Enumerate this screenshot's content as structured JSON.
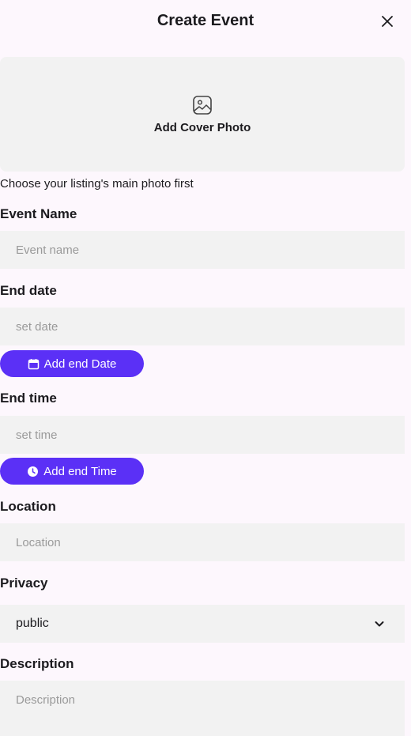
{
  "header": {
    "title": "Create Event"
  },
  "cover": {
    "label": "Add Cover Photo",
    "hint": "Choose your listing's main photo first"
  },
  "event_name": {
    "label": "Event Name",
    "placeholder": "Event name"
  },
  "end_date": {
    "label": "End date",
    "placeholder": "set date",
    "button": "Add end Date"
  },
  "end_time": {
    "label": "End time",
    "placeholder": "set time",
    "button": "Add end Time"
  },
  "location": {
    "label": "Location",
    "placeholder": "Location"
  },
  "privacy": {
    "label": "Privacy",
    "value": "public"
  },
  "description": {
    "label": "Description",
    "placeholder": "Description"
  },
  "colors": {
    "accent": "#5b30f6",
    "field_bg": "#f2f2f2",
    "page_bg": "#fdf7fd"
  }
}
